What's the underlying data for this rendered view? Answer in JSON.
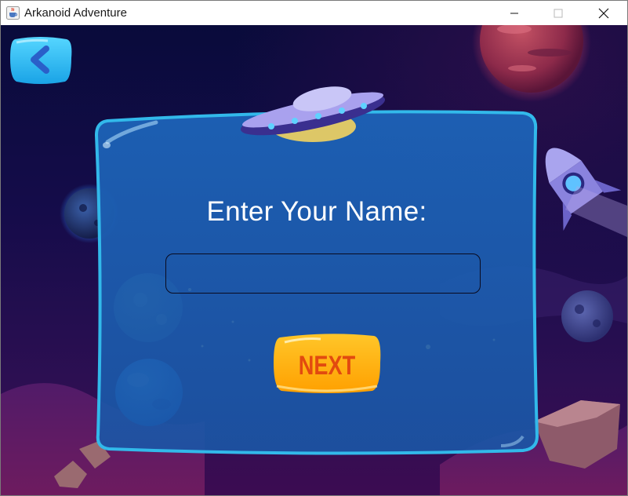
{
  "window": {
    "title": "Arkanoid Adventure",
    "app_icon": "java-cup-icon",
    "controls": [
      "minimize-icon",
      "maximize-icon",
      "close-icon"
    ]
  },
  "screen": {
    "prompt": "Enter Your Name:",
    "name_input": {
      "value": "",
      "placeholder": ""
    },
    "next_button": {
      "label": "NEXT"
    },
    "back_button": {
      "icon": "chevron-left-icon"
    }
  },
  "colors": {
    "panel": "#1a5bb0",
    "panel_border": "#2bb6e8",
    "next_button": "#ffb300",
    "next_text": "#e24a0f",
    "back_button": "#36c5f3"
  }
}
